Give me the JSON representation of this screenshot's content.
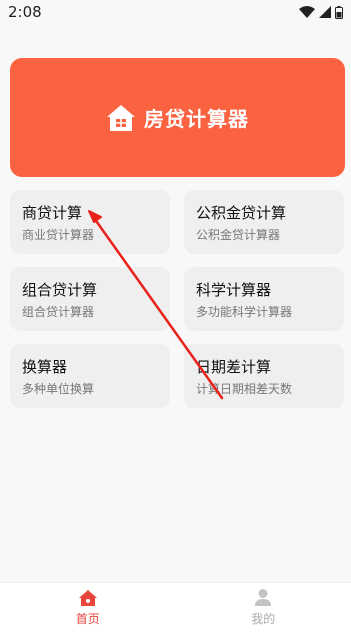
{
  "status_bar": {
    "time": "2:08"
  },
  "hero": {
    "title": "房贷计算器",
    "icon": "house-icon",
    "color": "#fb6240"
  },
  "cards": [
    {
      "title": "商贷计算",
      "subtitle": "商业贷计算器"
    },
    {
      "title": "公积金贷计算",
      "subtitle": "公积金贷计算器"
    },
    {
      "title": "组合贷计算",
      "subtitle": "组合贷计算器"
    },
    {
      "title": "科学计算器",
      "subtitle": "多功能科学计算器"
    },
    {
      "title": "换算器",
      "subtitle": "多种单位换算"
    },
    {
      "title": "日期差计算",
      "subtitle": "计算日期相差天数"
    }
  ],
  "bottom_nav": {
    "items": [
      {
        "label": "首页",
        "icon": "home-icon",
        "active": true
      },
      {
        "label": "我的",
        "icon": "user-icon",
        "active": false
      }
    ],
    "active_color": "#e8453c",
    "inactive_color": "#aaaaaa"
  },
  "annotation": {
    "color": "#e8211b"
  }
}
